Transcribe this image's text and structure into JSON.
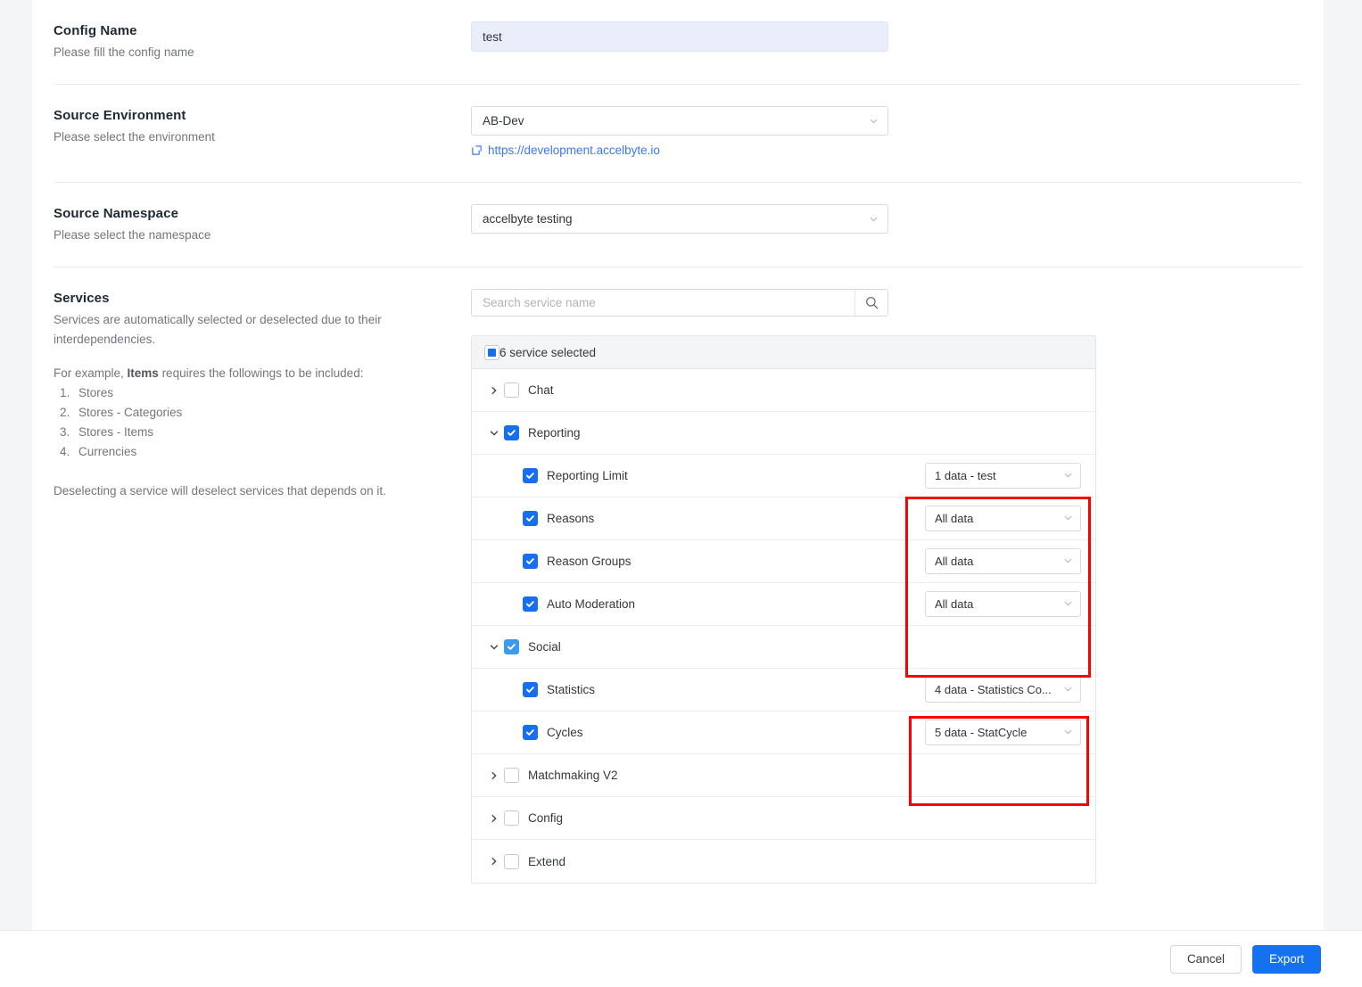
{
  "config_name": {
    "title": "Config Name",
    "description": "Please fill the config name",
    "value": "test",
    "placeholder": ""
  },
  "source_environment": {
    "title": "Source Environment",
    "description": "Please select the environment",
    "value": "AB-Dev",
    "link_text": "https://development.accelbyte.io",
    "link_icon": "external-link-icon"
  },
  "source_namespace": {
    "title": "Source Namespace",
    "description": "Please select the namespace",
    "value": "accelbyte testing"
  },
  "services": {
    "title": "Services",
    "description": "Services are automatically selected or deselected due to their interdependencies.",
    "example_prefix": "For example, ",
    "example_bold": "Items",
    "example_suffix": " requires the followings to be included:",
    "example_list": [
      "Stores",
      "Stores - Categories",
      "Stores - Items",
      "Currencies"
    ],
    "note": "Deselecting a service will deselect services that depends on it.",
    "search_placeholder": "Search service name",
    "search_value": "",
    "search_icon": "search-icon",
    "selected_summary": "6 service selected",
    "selected_state": "indeterminate",
    "rows": [
      {
        "label": "Chat",
        "type": "group",
        "expanded": false,
        "checked": false,
        "twisty": "chevron-right-icon"
      },
      {
        "label": "Reporting",
        "type": "group",
        "expanded": true,
        "checked": true,
        "twisty": "chevron-down-icon"
      },
      {
        "label": "Reporting Limit",
        "type": "child",
        "checked": true,
        "data_value": "1 data - test"
      },
      {
        "label": "Reasons",
        "type": "child",
        "checked": true,
        "data_value": "All data"
      },
      {
        "label": "Reason Groups",
        "type": "child",
        "checked": true,
        "data_value": "All data"
      },
      {
        "label": "Auto Moderation",
        "type": "child",
        "checked": true,
        "data_value": "All data"
      },
      {
        "label": "Social",
        "type": "group",
        "expanded": true,
        "checked": true,
        "highlight": true,
        "twisty": "chevron-down-icon"
      },
      {
        "label": "Statistics",
        "type": "child",
        "checked": true,
        "data_value": "4 data - Statistics Co..."
      },
      {
        "label": "Cycles",
        "type": "child",
        "checked": true,
        "data_value": "5 data - StatCycle"
      },
      {
        "label": "Matchmaking V2",
        "type": "group",
        "expanded": false,
        "checked": false,
        "twisty": "chevron-right-icon"
      },
      {
        "label": "Config",
        "type": "group",
        "expanded": false,
        "checked": false,
        "twisty": "chevron-right-icon"
      },
      {
        "label": "Extend",
        "type": "group",
        "expanded": false,
        "checked": false,
        "twisty": "chevron-right-icon"
      }
    ]
  },
  "footer": {
    "cancel_label": "Cancel",
    "export_label": "Export"
  },
  "colors": {
    "accent": "#1472f0",
    "checkbox_checked": "#176fef",
    "checkbox_highlight": "#3b9bf0",
    "link": "#3b78f0",
    "annotation": "#fe0000",
    "input_filled_bg": "#e9eefa",
    "page_bg": "#f4f5f7"
  }
}
